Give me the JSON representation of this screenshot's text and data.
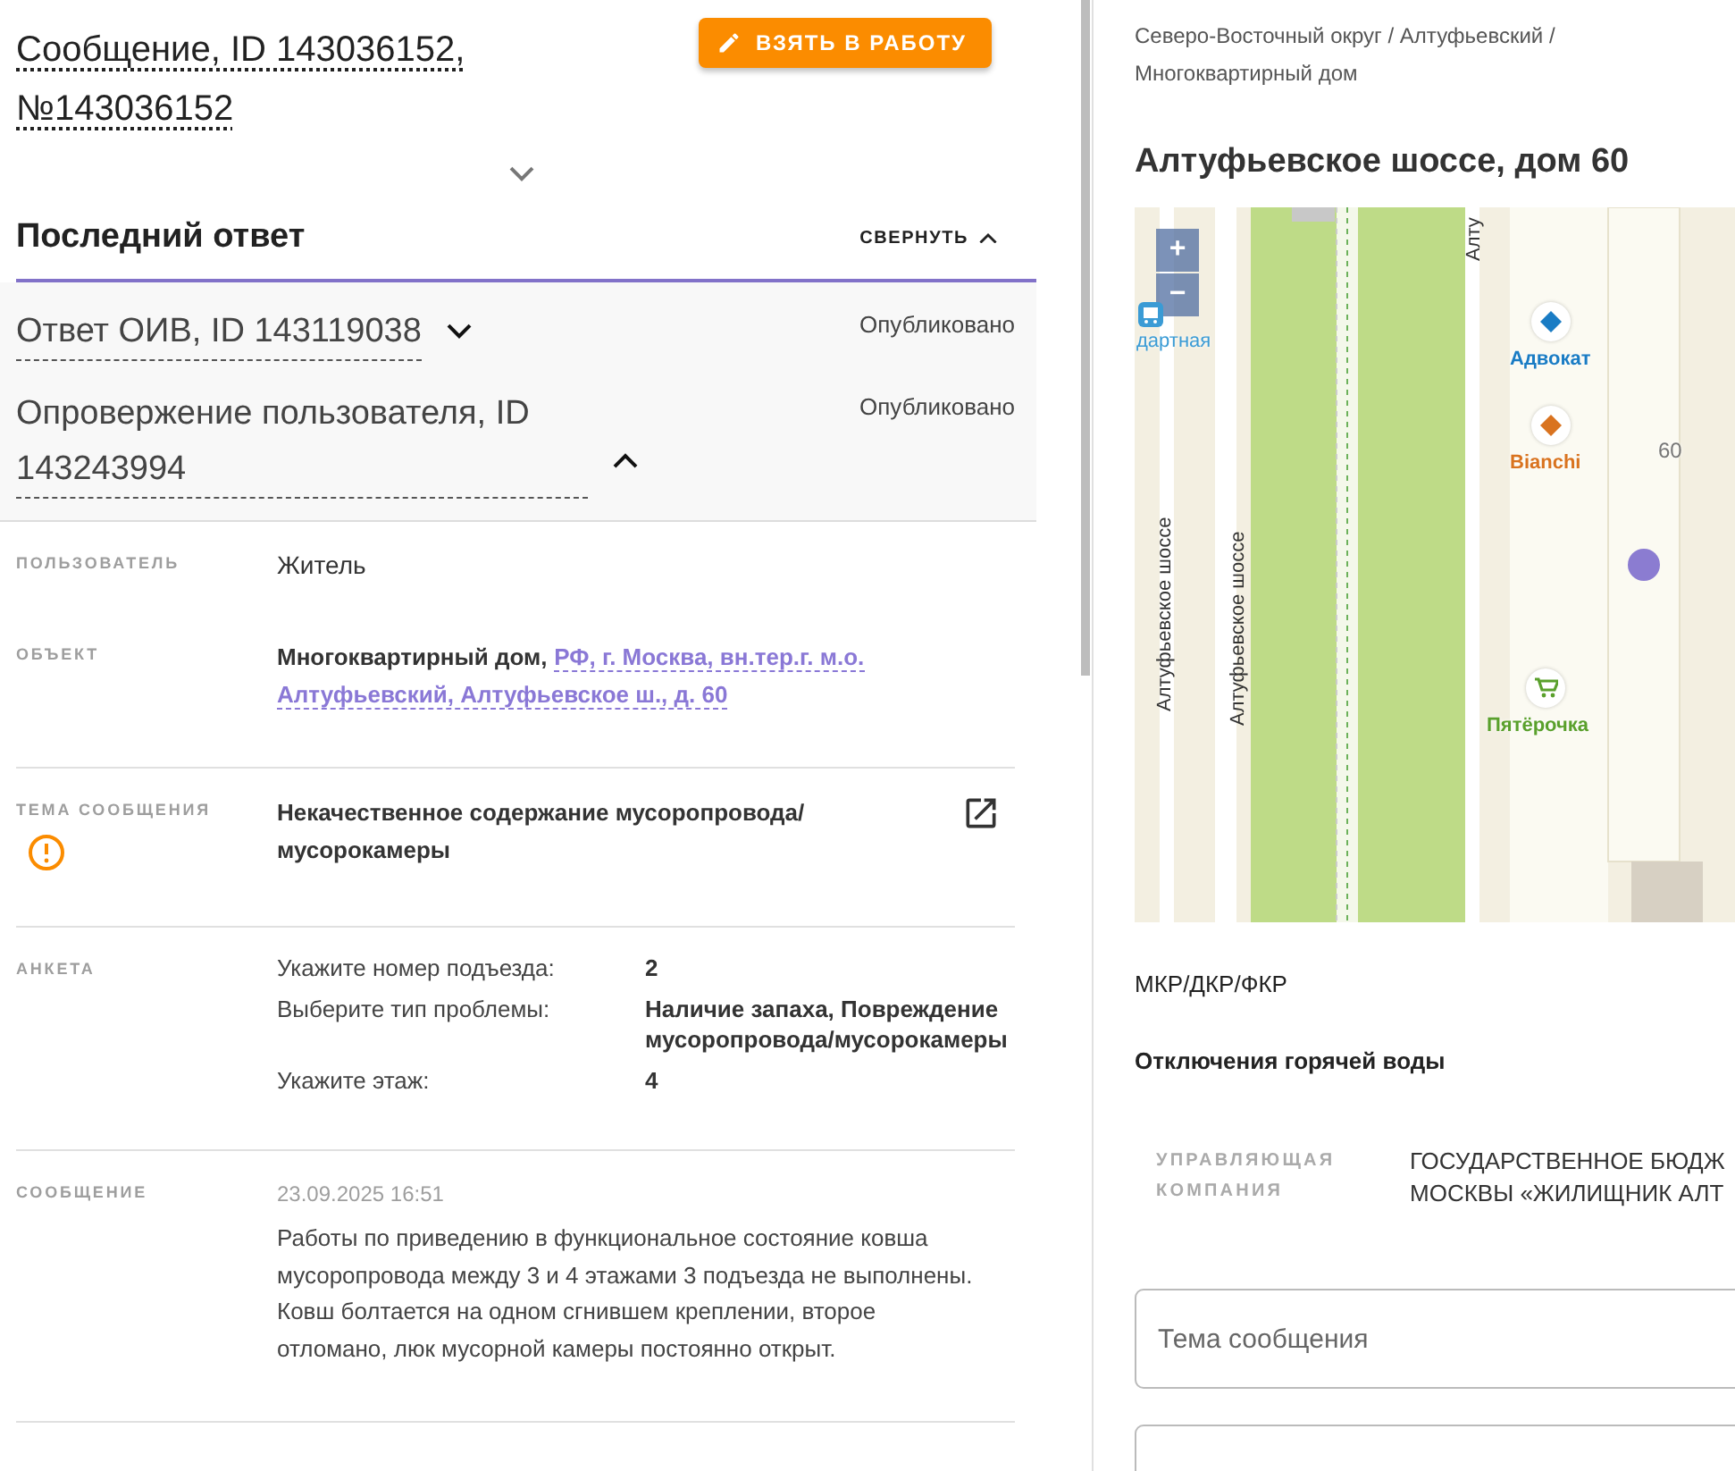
{
  "message_header": {
    "title": "Сообщение, ID 143036152, №143036152",
    "expanded": false,
    "action_button": "ВЗЯТЬ В РАБОТУ"
  },
  "last_answer": {
    "title": "Последний ответ",
    "toggle": "СВЕРНУТЬ",
    "expanded": true,
    "items": [
      {
        "title": "Ответ ОИВ, ID 143119038",
        "status": "Опубликовано",
        "expanded": false
      },
      {
        "title": "Опровержение пользователя, ID 143243994",
        "status": "Опубликовано",
        "expanded": true
      }
    ]
  },
  "details": [
    {
      "kind": "text",
      "label": "ПОЛЬЗОВАТЕЛЬ",
      "value": "Житель"
    },
    {
      "kind": "object",
      "label": "ОБЪЕКТ",
      "object_type": "Многоквартирный дом,",
      "address": "РФ, г. Москва, вн.тер.г. м.о. Алтуфьевский, Алтуфьевское ш., д. 60"
    },
    {
      "kind": "topic",
      "label": "ТЕМА СООБЩЕНИЯ",
      "value": "Некачественное содержание мусоропровода/ мусорокамеры",
      "warning": true
    },
    {
      "kind": "form",
      "label": "АНКЕТА",
      "answers": [
        {
          "question": "Укажите номер подъезда:",
          "answer": "2"
        },
        {
          "question": "Выберите тип проблемы:",
          "answer": "Наличие запаха, Повреждение мусоропровода/мусорокамеры"
        },
        {
          "question": "Укажите этаж:",
          "answer": "4"
        }
      ]
    },
    {
      "kind": "message",
      "label": "СООБЩЕНИЕ",
      "date": "23.09.2025 16:51",
      "value": "Работы по приведению в функциональное состояние ковша мусоропровода между 3 и 4 этажами 3 подъезда не выполнены. Ковш болтается на одном сгнившем креплении, второе отломано, люк мусорной камеры постоянно открыт."
    }
  ],
  "object_panel": {
    "breadcrumb": "Северо-Восточный округ / Алтуфьевский / Многоквартирный дом",
    "title": "Алтуфьевское шоссе, дом 60",
    "map": {
      "zoom_in": "+",
      "zoom_out": "−",
      "labels": [
        {
          "kind": "road",
          "text": "Алтуфьевское шоссе"
        },
        {
          "kind": "road",
          "text": "Алтуфьевское шоссе"
        },
        {
          "kind": "road",
          "text": "Алту"
        },
        {
          "kind": "stop",
          "text": "дартная",
          "color": "#3a9bd5"
        },
        {
          "kind": "place",
          "text": "Адвокат",
          "color": "#1a7cc4"
        },
        {
          "kind": "place",
          "text": "Bianchi",
          "color": "#d9731f"
        },
        {
          "kind": "house",
          "text": "60"
        },
        {
          "kind": "shop",
          "text": "Пятёрочка",
          "color": "#5aa02c"
        }
      ]
    },
    "sections": [
      "МКР/ДКР/ФКР",
      "Отключения горячей воды"
    ],
    "company": {
      "label": "УПРАВЛЯЮЩАЯ КОМПАНИЯ",
      "lines": [
        "ГОСУДАРСТВЕННОЕ БЮДЖ",
        "МОСКВЫ «ЖИЛИЩНИК АЛТ"
      ]
    },
    "fields": [
      {
        "kind": "input",
        "placeholder": "Тема сообщения"
      },
      {
        "kind": "input"
      }
    ]
  }
}
